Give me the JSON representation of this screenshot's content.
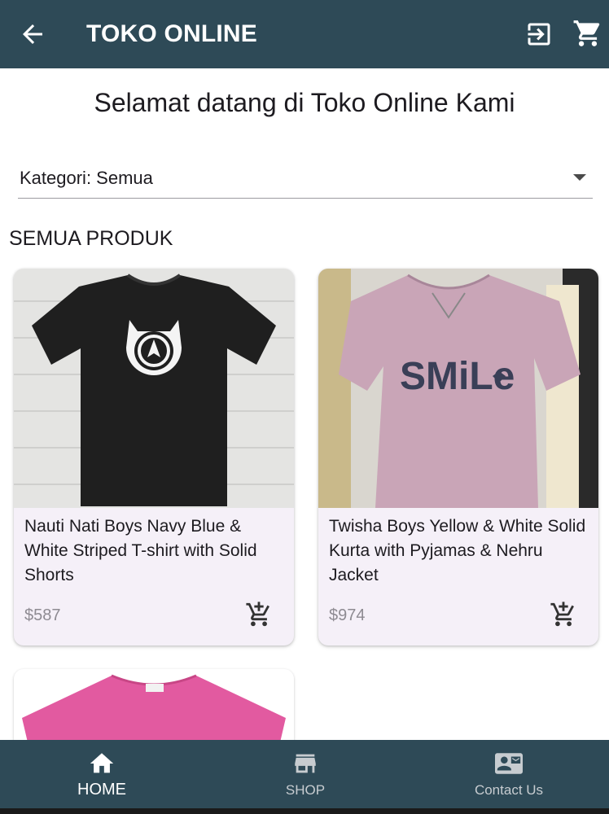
{
  "appbar": {
    "title": "TOKO ONLINE",
    "back_icon": "arrow-back-icon",
    "logout_icon": "logout-icon",
    "cart_icon": "shopping-cart-icon"
  },
  "welcome": "Selamat datang di Toko Online Kami",
  "category": {
    "label": "Kategori: Semua"
  },
  "section_title": "SEMUA PRODUK",
  "products": [
    {
      "name": "Nauti Nati Boys Navy Blue & White Striped T-shirt with Solid Shorts",
      "price": "$587",
      "image": "black-tshirt-image"
    },
    {
      "name": "Twisha Boys Yellow & White Solid Kurta with Pyjamas & Nehru Jacket",
      "price": "$974",
      "image": "pink-smile-tshirt-image"
    },
    {
      "name": "",
      "price": "",
      "image": "pink-tshirt-image"
    }
  ],
  "bottom_nav": [
    {
      "label": "HOME",
      "icon": "home-icon",
      "active": true
    },
    {
      "label": "SHOP",
      "icon": "store-icon",
      "active": false
    },
    {
      "label": "Contact Us",
      "icon": "contact-card-icon",
      "active": false
    }
  ],
  "colors": {
    "primary": "#2e4a57",
    "card_bg": "#f5f0f8",
    "price": "#8e8b92"
  }
}
